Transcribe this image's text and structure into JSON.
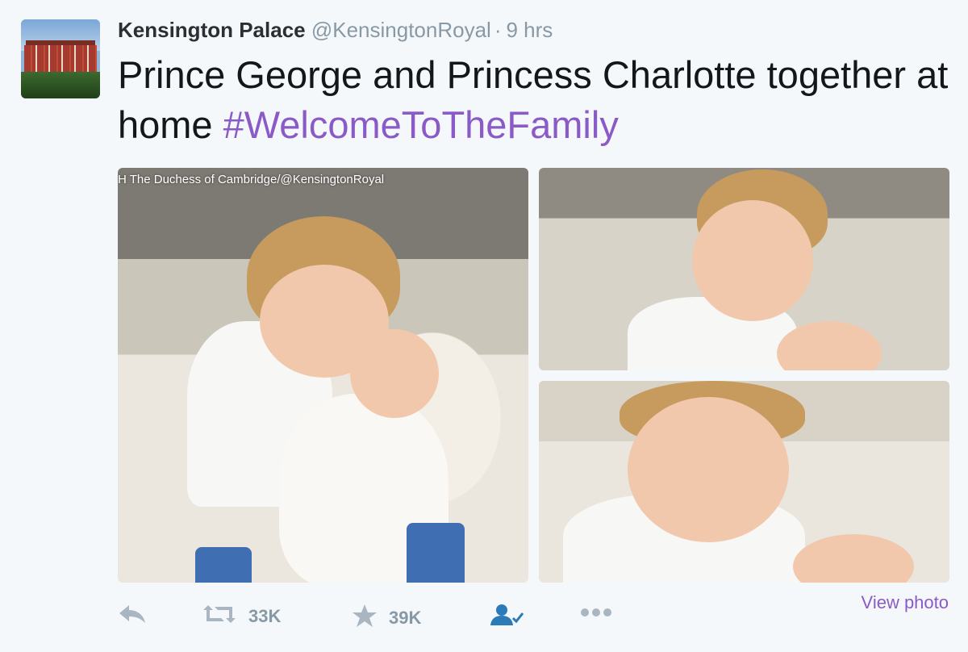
{
  "tweet": {
    "author": {
      "name": "Kensington Palace",
      "handle": "@KensingtonRoyal",
      "separator": "·",
      "time": "9 hrs"
    },
    "text": {
      "main": "Prince George and Princess Charlotte together at home",
      "hashtag": "#WelcomeToTheFamily"
    },
    "photos": {
      "credit": "H The Duchess of Cambridge/@KensingtonRoyal"
    },
    "actions": {
      "reply_icon": "reply-icon",
      "retweet_icon": "retweet-icon",
      "retweet_count": "33K",
      "favorite_icon": "star-icon",
      "favorite_count": "39K",
      "follow_icon": "follow-user-icon",
      "more_icon": "more-dots-icon",
      "view_photo": "View photo"
    },
    "colors": {
      "hashtag": "#8a5bc7",
      "muted": "#8899a6",
      "follow": "#2b7bb9"
    }
  }
}
